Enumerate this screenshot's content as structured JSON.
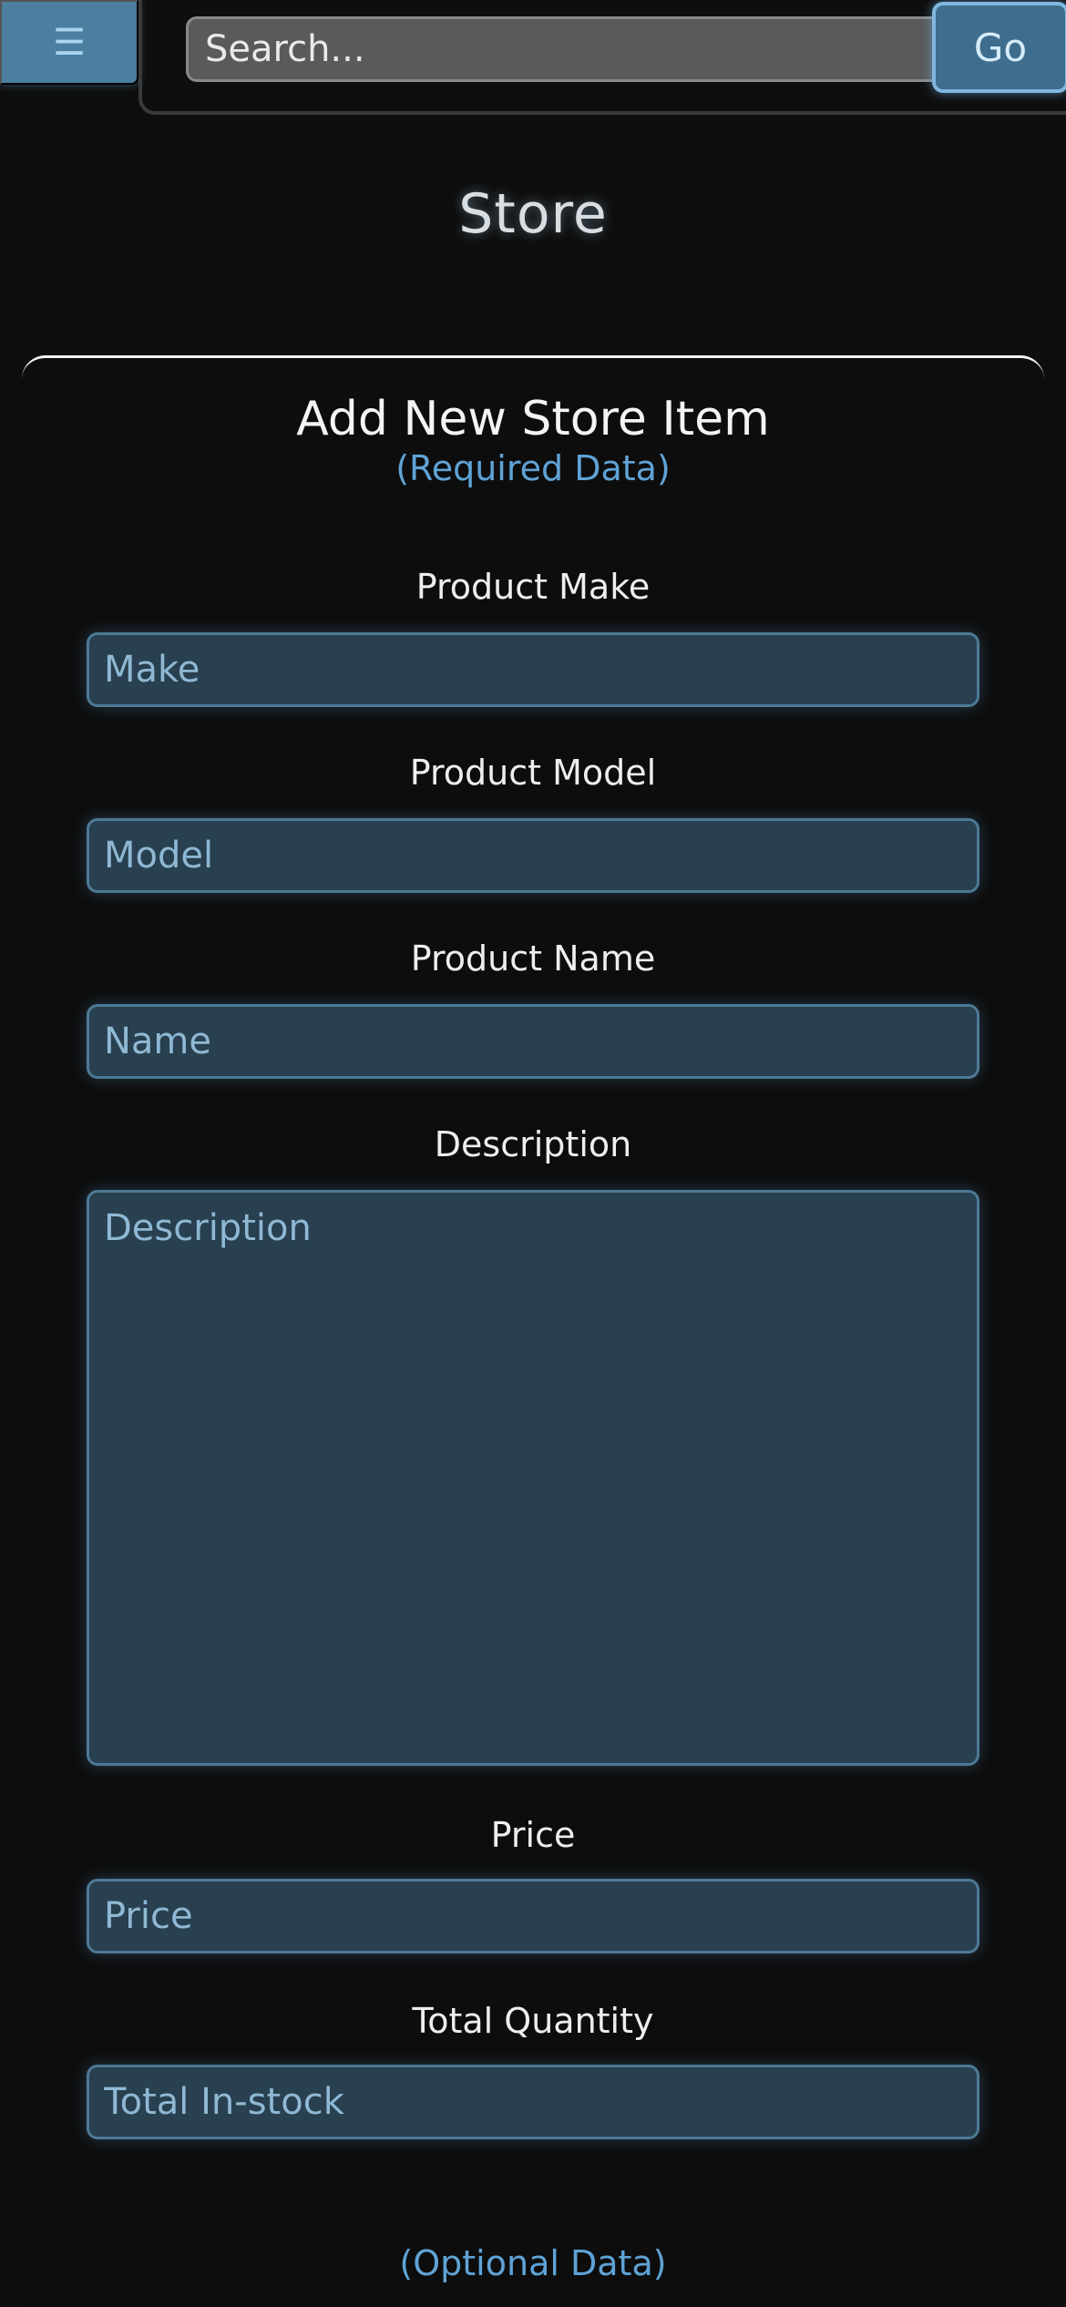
{
  "header": {
    "menu_icon": "hamburger-icon",
    "menu_glyph": "☰",
    "search_placeholder": "Search...",
    "go_label": "Go"
  },
  "page": {
    "title": "Store"
  },
  "form": {
    "title": "Add New Store Item",
    "required_note": "(Required Data)",
    "fields": [
      {
        "label": "Product Make",
        "placeholder": "Make"
      },
      {
        "label": "Product Model",
        "placeholder": "Model"
      },
      {
        "label": "Product Name",
        "placeholder": "Name"
      },
      {
        "label": "Description",
        "placeholder": "Description"
      },
      {
        "label": "Price",
        "placeholder": "Price"
      },
      {
        "label": "Total Quantity",
        "placeholder": "Total In-stock"
      }
    ],
    "optional_note": "(Optional Data)"
  },
  "colors": {
    "accent": "#5fa3d6",
    "field_bg": "#28404f",
    "button_bg": "#3f6d8d"
  }
}
